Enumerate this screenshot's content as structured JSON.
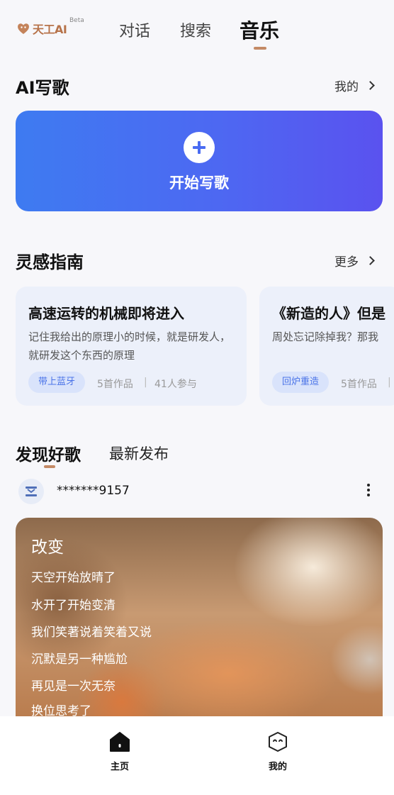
{
  "header": {
    "logo_text": "天工AI",
    "beta": "Beta",
    "tabs": [
      {
        "label": "对话"
      },
      {
        "label": "搜索"
      },
      {
        "label": "音乐"
      }
    ],
    "active_tab": "音乐"
  },
  "ai_write": {
    "title": "AI写歌",
    "more": "我的",
    "start_label": "开始写歌",
    "icon": "plus-icon"
  },
  "inspiration": {
    "title": "灵感指南",
    "more": "更多",
    "cards": [
      {
        "title": "高速运转的机械即将进入",
        "desc": "记住我给出的原理小的时候，就是研发人，就研发这个东西的原理",
        "tag": "带上蓝牙",
        "works": "5首作品",
        "separator": "|",
        "participants": "41人参与"
      },
      {
        "title": "《新造的人》但是",
        "desc": "周处忘记除掉我？那我",
        "tag": "回炉重造",
        "works": "5首作品",
        "separator": "|"
      }
    ]
  },
  "discover": {
    "tabs": [
      {
        "label": "发现好歌"
      },
      {
        "label": "最新发布"
      }
    ],
    "active_tab": "发现好歌",
    "post": {
      "username": "*******9157",
      "song_title": "改变",
      "lyrics": [
        "天空开始放晴了",
        "水开了开始变清",
        "我们笑著说着笑着又说",
        "沉默是另一种尴尬",
        "再见是一次无奈",
        "换位思考了"
      ]
    }
  },
  "bottom_nav": {
    "items": [
      {
        "label": "主页",
        "icon": "home-icon"
      },
      {
        "label": "我的",
        "icon": "profile-face-icon"
      }
    ]
  },
  "colors": {
    "accent_blue": "#4a6cf2",
    "tab_underline": "#c48a66",
    "tag_text": "#4b74e8"
  }
}
